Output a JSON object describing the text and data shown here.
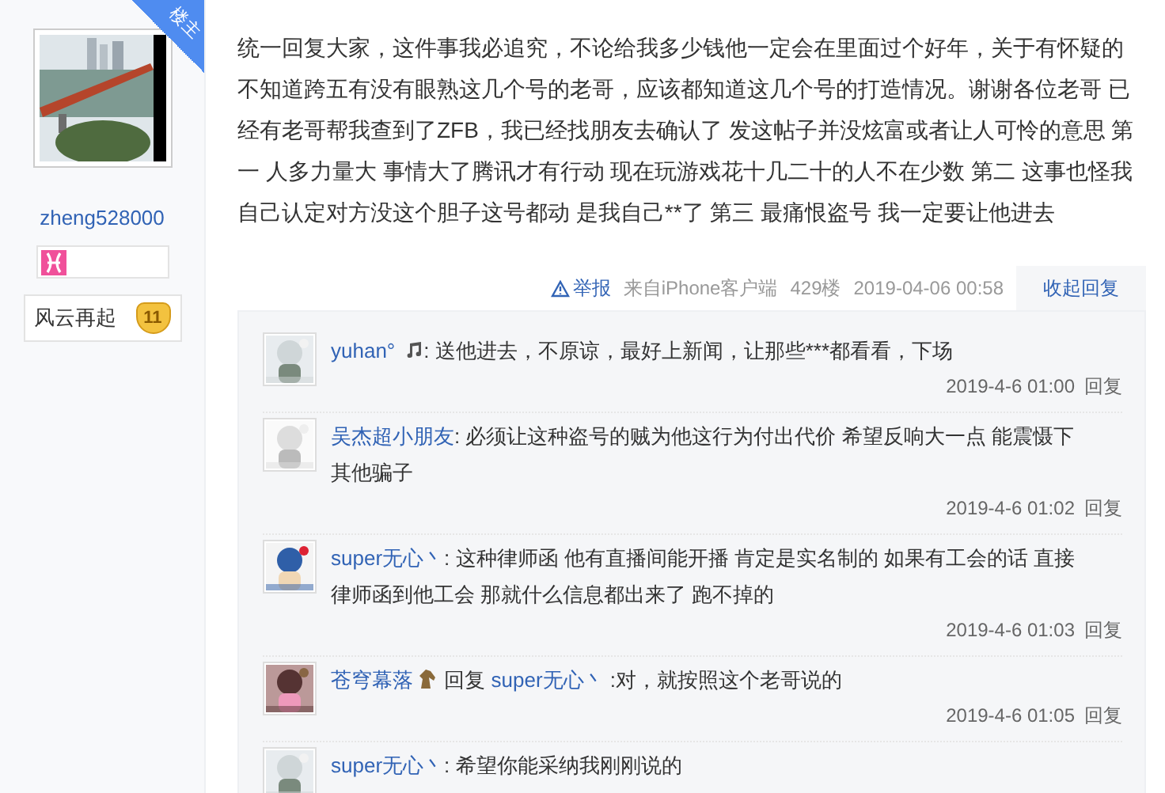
{
  "author": {
    "badge": "楼主",
    "username": "zheng528000",
    "level_name": "风云再起",
    "level": "11"
  },
  "post": {
    "body": "统一回复大家，这件事我必追究，不论给我多少钱他一定会在里面过个好年，关于有怀疑的不知道跨五有没有眼熟这几个号的老哥，应该都知道这几个号的打造情况。谢谢各位老哥 已经有老哥帮我查到了ZFB，我已经找朋友去确认了 发这帖子并没炫富或者让人可怜的意思 第一 人多力量大 事情大了腾讯才有行动 现在玩游戏花十几二十的人不在少数 第二 这事也怪我自己认定对方没这个胆子这号都动 是我自己**了 第三 最痛恨盗号 我一定要让他进去",
    "report": "举报",
    "source": "来自iPhone客户端",
    "floor": "429楼",
    "time": "2019-04-06 00:58",
    "toggle_replies": "收起回复"
  },
  "replies": [
    {
      "author": "yuhan°",
      "kind": "note",
      "text": ": 送他进去，不原谅，最好上新闻，让那些***都看看，下场",
      "time": "2019-4-6 01:00",
      "reply": "回复"
    },
    {
      "author": "吴杰超小朋友",
      "kind": "plain",
      "text": ": 必须让这种盗号的贼为他这行为付出代价 希望反响大一点 能震慑下其他骗子",
      "time": "2019-4-6 01:02",
      "reply": "回复"
    },
    {
      "author": "super无心丶",
      "kind": "plain",
      "text": ": 这种律师函 他有直播间能开播 肯定是实名制的 如果有工会的话 直接律师函到他工会 那就什么信息都出来了 跑不掉的",
      "time": "2019-4-6 01:03",
      "reply": "回复"
    },
    {
      "author": "苍穹幕落",
      "kind": "horse",
      "reply_to_label": "回复",
      "reply_to": "super无心丶",
      "text": ":对，就按照这个老哥说的",
      "time": "2019-4-6 01:05",
      "reply": "回复"
    },
    {
      "author": "super无心丶",
      "kind": "plain",
      "text": ": 希望你能采纳我刚刚说的"
    }
  ]
}
